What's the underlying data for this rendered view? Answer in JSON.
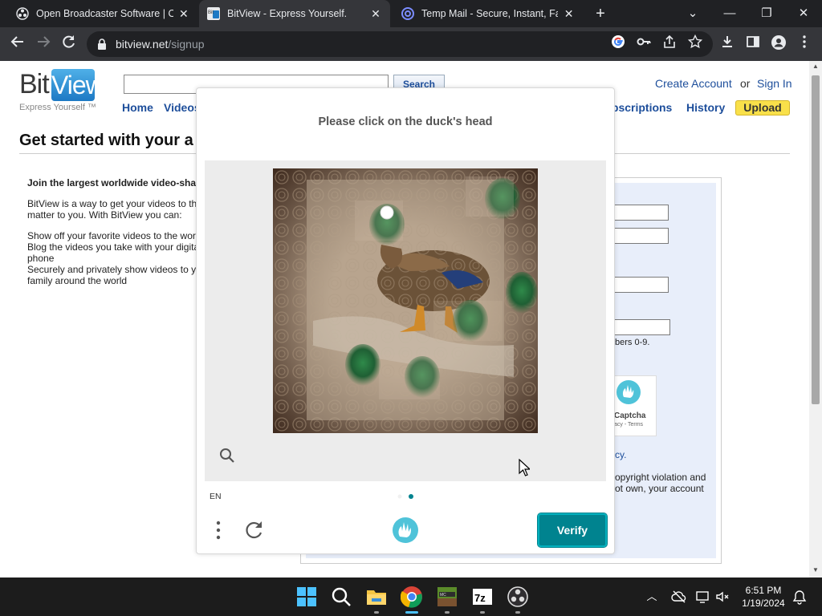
{
  "browser": {
    "tabs": [
      {
        "title": "Open Broadcaster Software | OBS",
        "icon": "obs-icon",
        "active": false
      },
      {
        "title": "BitView - Express Yourself.",
        "icon": "bitview-icon",
        "active": true
      },
      {
        "title": "Temp Mail - Secure, Instant, Fast",
        "icon": "tempmail-icon",
        "active": false
      }
    ],
    "url_host": "bitview.net",
    "url_path": "/signup"
  },
  "site": {
    "logo_bit": "Bit",
    "logo_view": "View",
    "tagline": "Express Yourself ™",
    "search_button": "Search",
    "nav": {
      "home": "Home",
      "videos": "Videos",
      "subscriptions": "Subscriptions",
      "history": "History",
      "upload": "Upload"
    },
    "create_account": "Create Account",
    "or": "or",
    "sign_in": "Sign In"
  },
  "signup": {
    "title": "Get started with your a",
    "intro_heading": "Join the largest worldwide video-sha",
    "intro_lines": [
      "BitView is a way to get your videos to th",
      "matter to you. With BitView you can:",
      "Show off your favorite videos to the wor",
      "Blog the videos you take with your digita",
      "phone",
      "Securely and privately show videos to y",
      "family around the world"
    ],
    "username_note": "bers 0-9.",
    "captcha_label": "Captcha",
    "captcha_sub": "acy - Terms",
    "privacy_fragment": "cy.",
    "terms_lines": [
      "opyright violation and",
      "ot own, your account"
    ]
  },
  "captcha_modal": {
    "prompt": "Please click on the duck's head",
    "language": "EN",
    "verify_label": "Verify",
    "accent_color": "#00838f"
  },
  "taskbar": {
    "apps": [
      "windows-start-icon",
      "search-icon",
      "file-explorer-icon",
      "chrome-icon",
      "minecraft-icon",
      "7zip-icon",
      "obs-icon"
    ],
    "time": "6:51 PM",
    "date": "1/19/2024"
  }
}
